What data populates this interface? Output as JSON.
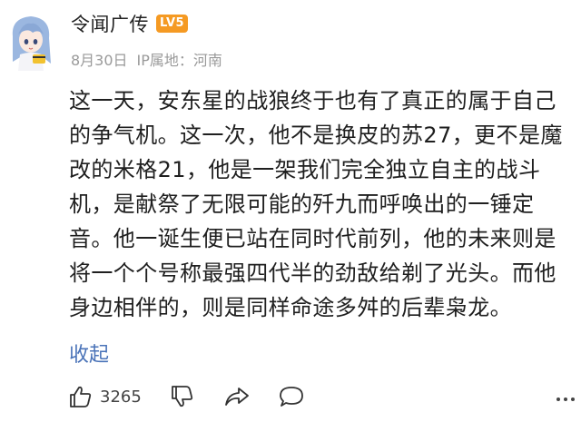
{
  "comment": {
    "username": "令闻广传",
    "level_badge": "LV5",
    "date": "8月30日",
    "ip_location": "IP属地：河南",
    "text": "这一天，安东星的战狼终于也有了真正的属于自己的争气机。这一次，他不是换皮的苏27，更不是魔改的米格21，他是一架我们完全独立自主的战斗机，是献祭了无限可能的歼九而呼唤出的一锤定音。他一诞生便已站在同时代前列，他的未来则是将一个个号称最强四代半的劲敌给剃了光头。而他身边相伴的，则是同样命途多舛的后辈枭龙。",
    "collapse_label": "收起",
    "like_count": "3265"
  },
  "colors": {
    "badge": "#f59a23",
    "link": "#4a73b8",
    "meta": "#9a9a9a"
  },
  "icons": [
    "avatar",
    "thumbs-up-icon",
    "thumbs-down-icon",
    "share-icon",
    "comment-icon",
    "more-icon"
  ]
}
